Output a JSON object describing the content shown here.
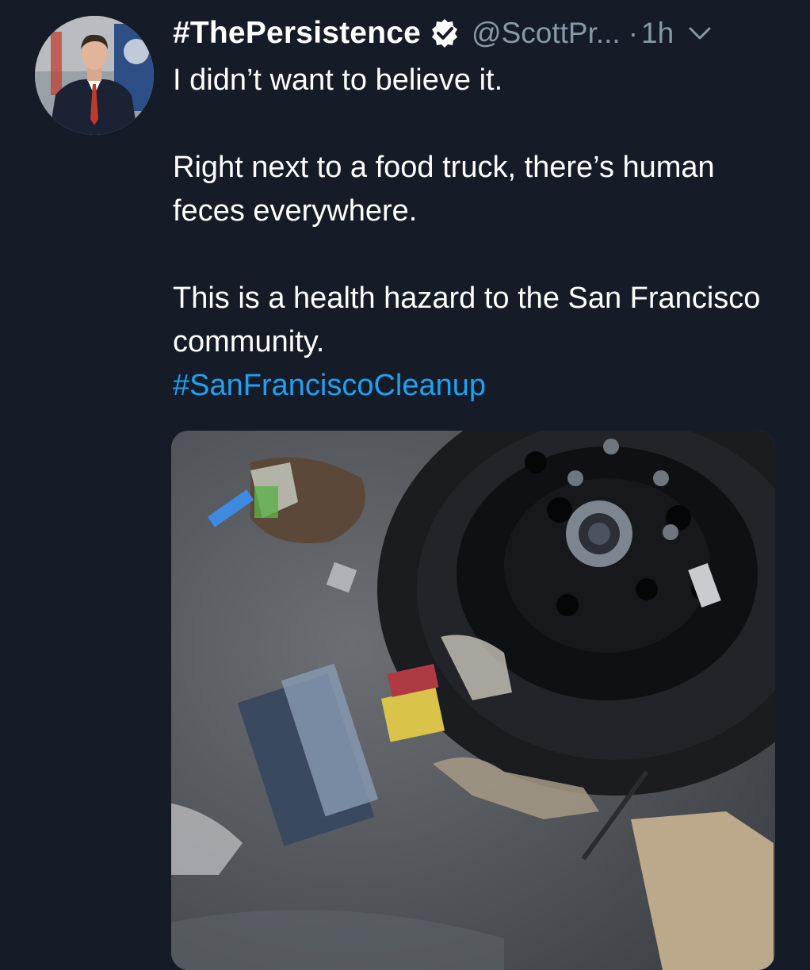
{
  "tweet": {
    "display_name": "#ThePersistence",
    "handle": "@ScottPr...",
    "separator": "·",
    "time": "1h",
    "lines": {
      "l1": "I didn’t want to believe it.",
      "l2": "Right next to a food truck, there’s human feces everywhere.",
      "l3": "This is a health hazard to the San Francisco community."
    },
    "hashtag": "#SanFranciscoCleanup",
    "icons": {
      "verified": "verified-badge-icon",
      "menu": "chevron-down-icon"
    }
  },
  "colors": {
    "background": "#151c28",
    "text": "#ffffff",
    "secondary_text": "#8899a6",
    "link": "#1da1f2"
  }
}
